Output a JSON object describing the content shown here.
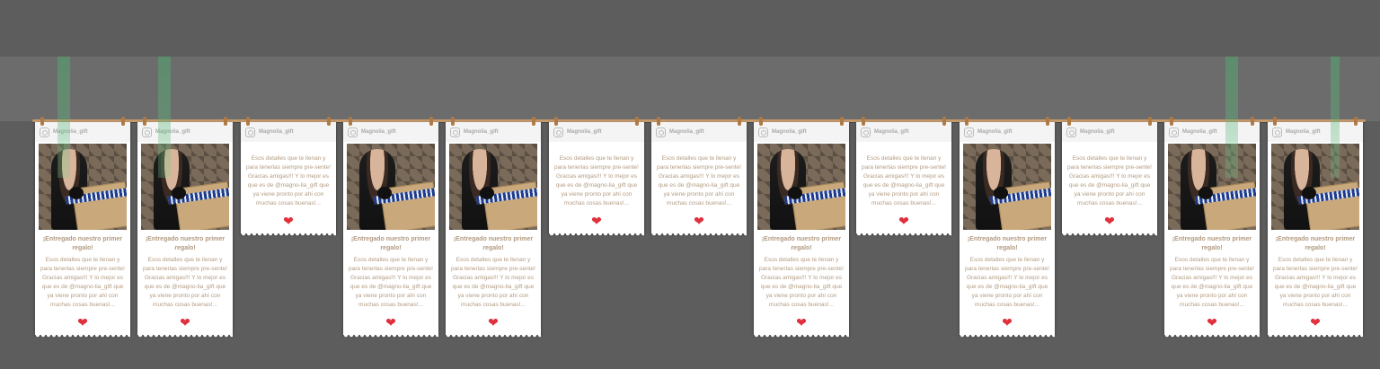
{
  "colors": {
    "background": "#5d5d5d",
    "rope": "#c49a6c",
    "heart": "#e0303c",
    "text": "#b39b82"
  },
  "card_content": {
    "username": "Magnolia_gift",
    "title": "¡Entregado nuestro primer regalo!",
    "caption": "Esos detalles que te llenan y para tenerlas siempre presente! Gracias amigas!!! Y lo mejor es que es de @magnolia_gift que ya viene pronto por ahí con muchas cosas buenas!...",
    "like_icon": "heart-icon",
    "account_icon": "instagram-icon"
  },
  "cards": [
    {
      "username": "Magnolia_gift",
      "title": "¡Entregado nuestro primer regalo!",
      "caption": "Esos detalles que te llenan y para tenerlas siempre pre-sente! Gracias amigas!!! Y lo mejor es que es de @magno-lia_gift que ya viene pronto por ahí con muchas cosas buenas!...",
      "has_photo": true
    },
    {
      "username": "Magnolia_gift",
      "title": "¡Entregado nuestro primer regalo!",
      "caption": "Esos detalles que te llenan y para tenerlas siempre pre-sente! Gracias amigas!!! Y lo mejor es que es de @magno-lia_gift que ya viene pronto por ahí con muchas cosas buenas!...",
      "has_photo": true
    },
    {
      "username": "Magnolia_gift",
      "title": "",
      "caption": "Esos detalles que te llenan y para tenerlas siempre pre-sente! Gracias amigas!!! Y lo mejor es que es de @magno-lia_gift que ya viene pronto por ahí con muchas cosas buenas!...",
      "has_photo": false
    },
    {
      "username": "Magnolia_gift",
      "title": "¡Entregado nuestro primer regalo!",
      "caption": "Esos detalles que te llenan y para tenerlas siempre pre-sente! Gracias amigas!!! Y lo mejor es que es de @magno-lia_gift que ya viene pronto por ahí con muchas cosas buenas!...",
      "has_photo": true
    },
    {
      "username": "Magnolia_gift",
      "title": "¡Entregado nuestro primer regalo!",
      "caption": "Esos detalles que te llenan y para tenerlas siempre pre-sente! Gracias amigas!!! Y lo mejor es que es de @magno-lia_gift que ya viene pronto por ahí con muchas cosas buenas!...",
      "has_photo": true
    },
    {
      "username": "Magnolia_gift",
      "title": "",
      "caption": "Esos detalles que te llenan y para tenerlas siempre pre-sente! Gracias amigas!!! Y lo mejor es que es de @magno-lia_gift que ya viene pronto por ahí con muchas cosas buenas!...",
      "has_photo": false
    },
    {
      "username": "Magnolia_gift",
      "title": "",
      "caption": "Esos detalles que te llenan y para tenerlas siempre pre-sente! Gracias amigas!!! Y lo mejor es que es de @magno-lia_gift que ya viene pronto por ahí con muchas cosas buenas!...",
      "has_photo": false
    },
    {
      "username": "Magnolia_gift",
      "title": "¡Entregado nuestro primer regalo!",
      "caption": "Esos detalles que te llenan y para tenerlas siempre pre-sente! Gracias amigas!!! Y lo mejor es que es de @magno-lia_gift que ya viene pronto por ahí con muchas cosas buenas!...",
      "has_photo": true
    },
    {
      "username": "Magnolia_gift",
      "title": "",
      "caption": "Esos detalles que te llenan y para tenerlas siempre pre-sente! Gracias amigas!!! Y lo mejor es que es de @magno-lia_gift que ya viene pronto por ahí con muchas cosas buenas!...",
      "has_photo": false
    },
    {
      "username": "Magnolia_gift",
      "title": "¡Entregado nuestro primer regalo!",
      "caption": "Esos detalles que te llenan y para tenerlas siempre pre-sente! Gracias amigas!!! Y lo mejor es que es de @magno-lia_gift que ya viene pronto por ahí con muchas cosas buenas!...",
      "has_photo": true
    },
    {
      "username": "Magnolia_gift",
      "title": "",
      "caption": "Esos detalles que te llenan y para tenerlas siempre pre-sente! Gracias amigas!!! Y lo mejor es que es de @magno-lia_gift que ya viene pronto por ahí con muchas cosas buenas!...",
      "has_photo": false
    },
    {
      "username": "Magnolia_gift",
      "title": "¡Entregado nuestro primer regalo!",
      "caption": "Esos detalles que te llenan y para tenerlas siempre pre-sente! Gracias amigas!!! Y lo mejor es que es de @magno-lia_gift que ya viene pronto por ahí con muchas cosas buenas!...",
      "has_photo": true
    },
    {
      "username": "Magnolia_gift",
      "title": "¡Entregado nuestro primer regalo!",
      "caption": "Esos detalles que te llenan y para tenerlas siempre pre-sente! Gracias amigas!!! Y lo mejor es que es de @magno-lia_gift que ya viene pronto por ahí con muchas cosas buenas!...",
      "has_photo": true
    }
  ]
}
